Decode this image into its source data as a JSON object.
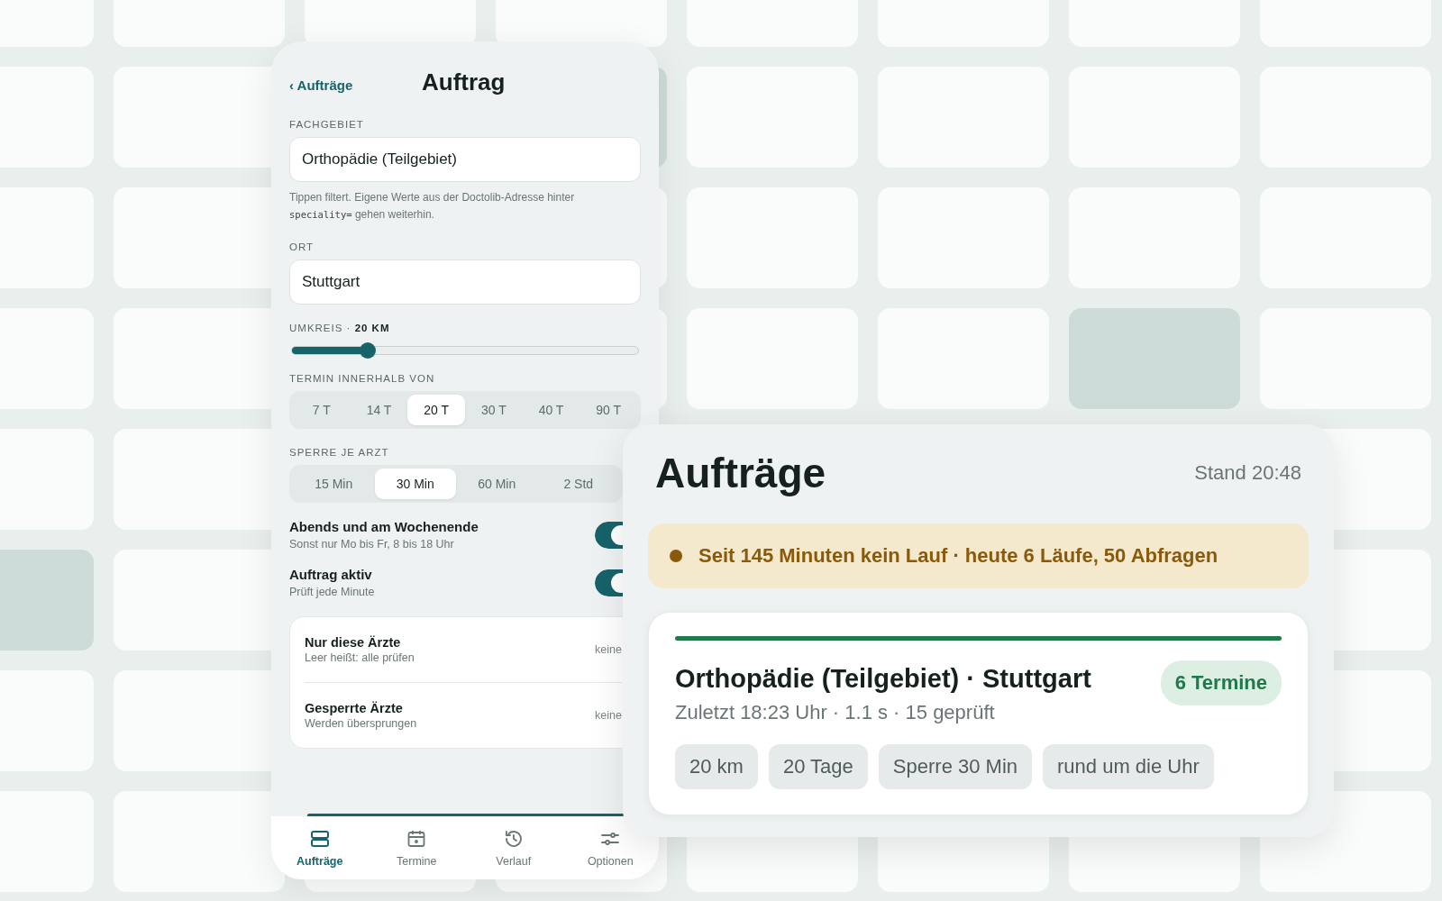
{
  "order_screen": {
    "back_link": "‹ Aufträge",
    "title": "Auftrag",
    "specialty": {
      "label": "FACHGEBIET",
      "value": "Orthopädie (Teilgebiet)"
    },
    "specialty_hint": [
      {
        "kind": "text",
        "text": "Tippen filtert. Eigene Werte aus der Doctolib-Adresse hinter "
      },
      {
        "kind": "code",
        "text": "speciality="
      },
      {
        "kind": "text",
        "text": " gehen weiterhin."
      }
    ],
    "location": {
      "label": "ORT",
      "value": "Stuttgart"
    },
    "radius": {
      "label": "UMKREIS · **20 KM**",
      "level": 0.22
    },
    "window": {
      "label": "TERMIN INNERHALB VON",
      "options": [
        {
          "label": "7 T",
          "selected": false
        },
        {
          "label": "14 T",
          "selected": false
        },
        {
          "label": "20 T",
          "selected": true
        },
        {
          "label": "30 T",
          "selected": false
        },
        {
          "label": "40 T",
          "selected": false
        },
        {
          "label": "90 T",
          "selected": false
        }
      ]
    },
    "cooldown": {
      "label": "SPERRE JE ARZT",
      "options": [
        {
          "label": "15 Min",
          "selected": false
        },
        {
          "label": "30 Min",
          "selected": true
        },
        {
          "label": "60 Min",
          "selected": false
        },
        {
          "label": "2 Std",
          "selected": false
        }
      ]
    },
    "toggles": [
      {
        "title": "Abends und am Wochenende",
        "subtitle": "Sonst nur Mo bis Fr, 8 bis 18 Uhr",
        "on": true
      },
      {
        "title": "Auftrag aktiv",
        "subtitle": "Prüft jede Minute",
        "on": true
      }
    ],
    "doctor_lists": [
      {
        "title": "Nur diese Ärzte",
        "subtitle": "Leer heißt: alle prüfen",
        "value": "keine"
      },
      {
        "title": "Gesperrte Ärzte",
        "subtitle": "Werden übersprungen",
        "value": "keine"
      }
    ],
    "tab_bar": [
      {
        "kind": "orders",
        "label": "Aufträge",
        "selected": true
      },
      {
        "kind": "calendar",
        "label": "Termine",
        "selected": false
      },
      {
        "kind": "history",
        "label": "Verlauf",
        "selected": false
      },
      {
        "kind": "sliders",
        "label": "Optionen",
        "selected": false
      }
    ]
  },
  "orders_screen": {
    "title": "Aufträge",
    "updated": "Stand 20:48",
    "status_banner": {
      "text": "Seit 145 Minuten kein Lauf · heute 6 Läufe, 50 Abfragen",
      "color": "#8a5a0b"
    },
    "order_card": {
      "title": "Orthopädie (Teilgebiet) · Stuttgart",
      "meta": "Zuletzt 18:23 Uhr · 1.1 s · 15 geprüft",
      "badge": "6 Termine",
      "chips": [
        "20 km",
        "20 Tage",
        "Sperre 30 Min",
        "rund um die Uhr"
      ]
    }
  }
}
